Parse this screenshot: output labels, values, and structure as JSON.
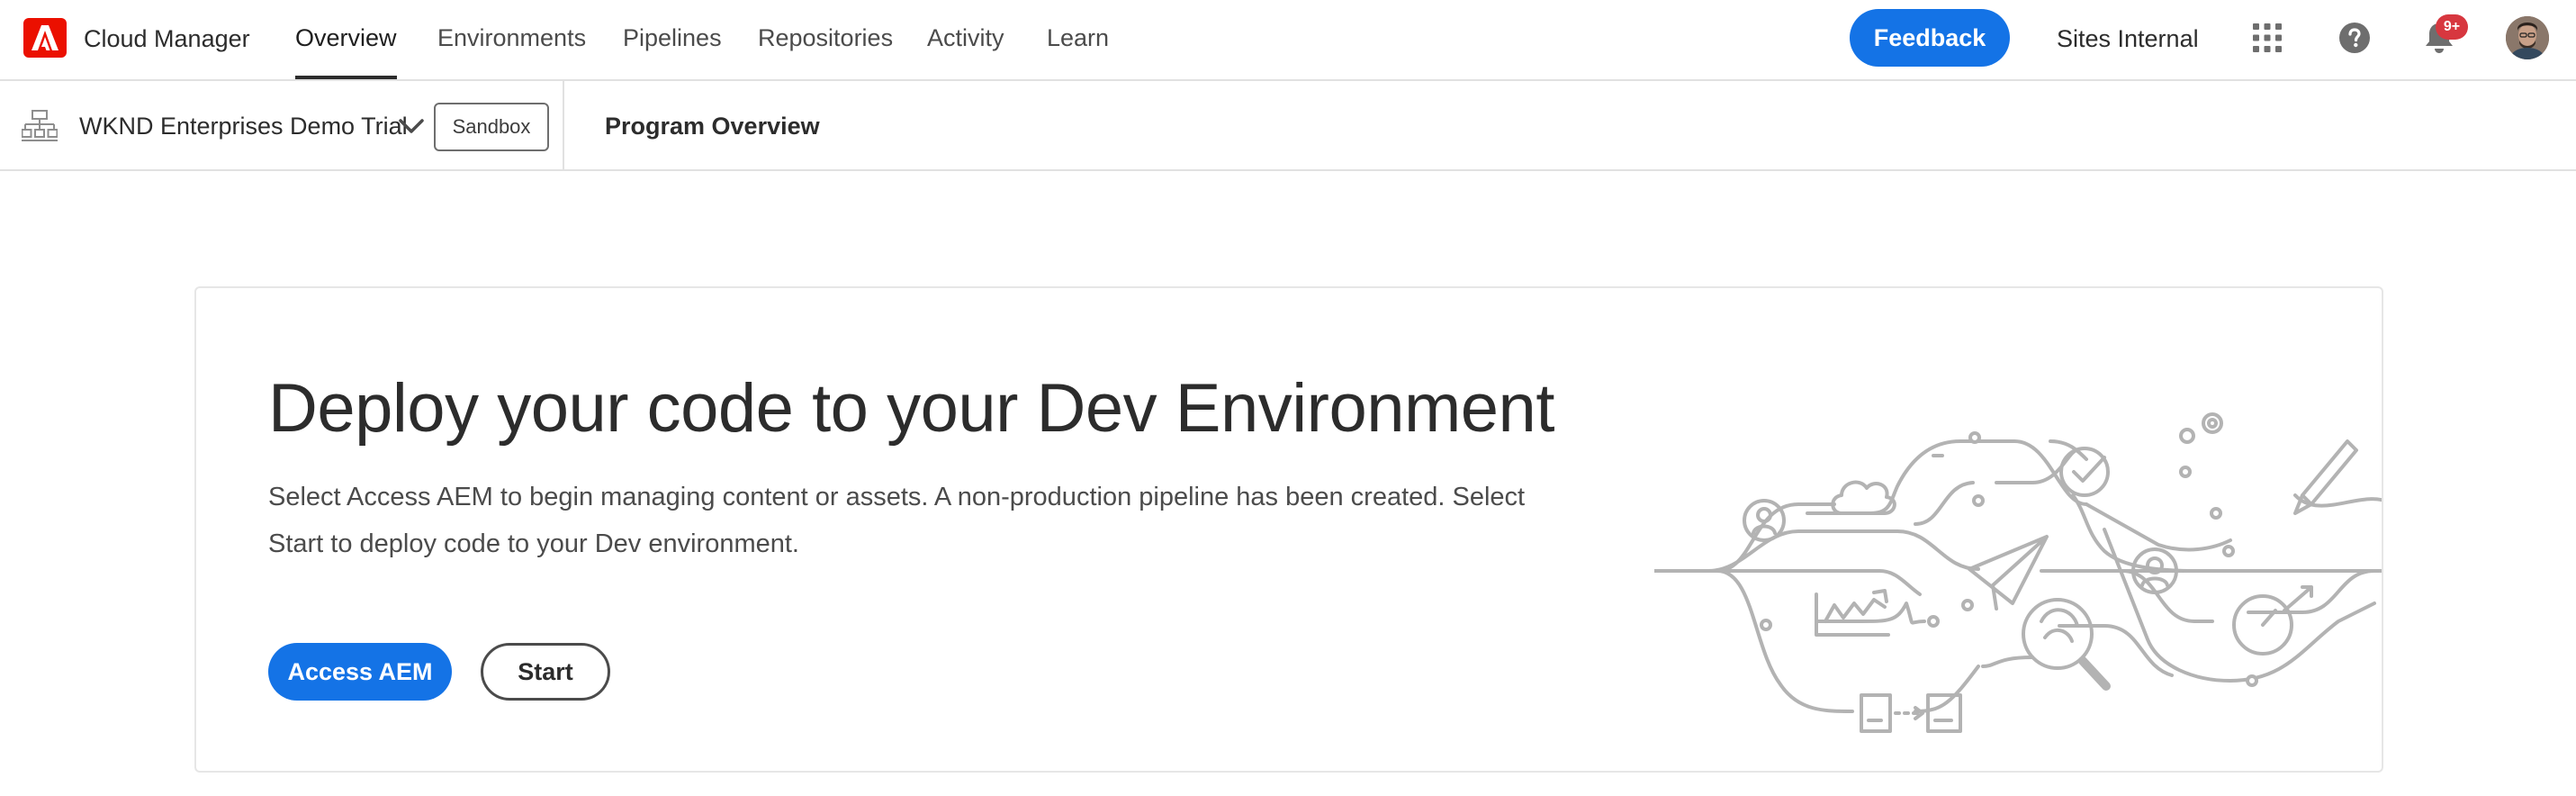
{
  "header": {
    "app_name": "Cloud Manager",
    "tabs": [
      {
        "label": "Overview",
        "active": true
      },
      {
        "label": "Environments",
        "active": false
      },
      {
        "label": "Pipelines",
        "active": false
      },
      {
        "label": "Repositories",
        "active": false
      },
      {
        "label": "Activity",
        "active": false
      },
      {
        "label": "Learn",
        "active": false
      }
    ],
    "feedback_label": "Feedback",
    "org_name": "Sites Internal",
    "notification_count": "9+",
    "icons": [
      "adobe-logo",
      "app-switcher-icon",
      "help-icon",
      "bell-icon",
      "avatar"
    ]
  },
  "program_bar": {
    "program_name": "WKND Enterprises Demo Trial",
    "environment_tag": "Sandbox",
    "breadcrumb": "Program Overview"
  },
  "card": {
    "title": "Deploy your code to your Dev Environment",
    "description": "Select Access AEM to begin managing content or assets. A non-production pipeline has been created. Select Start to deploy code to your Dev environment.",
    "primary_button": "Access AEM",
    "secondary_button": "Start"
  },
  "colors": {
    "accent": "#1473e6",
    "adobe_red": "#eb1000",
    "badge_red": "#d7373f",
    "illustration_gray": "#b3b3b3",
    "divider": "#e1e1e1"
  }
}
